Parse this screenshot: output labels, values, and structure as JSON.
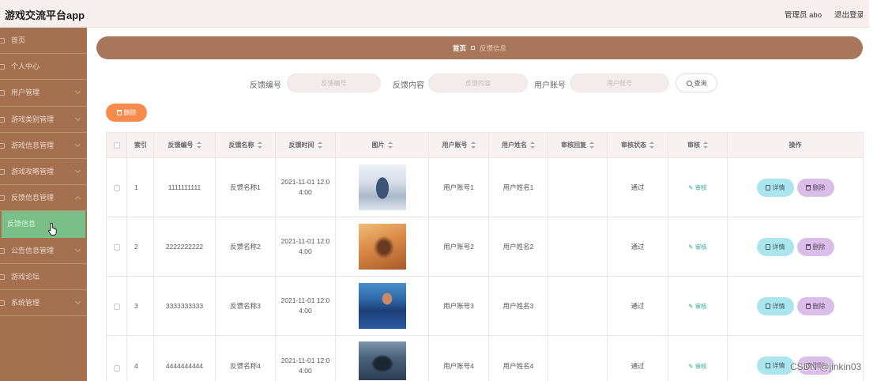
{
  "app": {
    "title": "游戏交流平台app",
    "user_label": "管理员 abo",
    "logout_label": "退出登录"
  },
  "sidebar": {
    "items": [
      {
        "label": "首页",
        "icon": "home-icon"
      },
      {
        "label": "个人中心",
        "icon": "person-icon"
      },
      {
        "label": "用户管理",
        "icon": "users-icon",
        "expandable": true
      },
      {
        "label": "游戏类别管理",
        "icon": "category-icon",
        "expandable": true
      },
      {
        "label": "游戏信息管理",
        "icon": "game-icon",
        "expandable": true
      },
      {
        "label": "游戏攻略管理",
        "icon": "guide-icon",
        "expandable": true
      },
      {
        "label": "反馈信息管理",
        "icon": "feedback-icon",
        "expandable": true,
        "expanded": true
      },
      {
        "label": "反馈信息",
        "active": true
      },
      {
        "label": "公告信息管理",
        "icon": "notice-icon",
        "expandable": true
      },
      {
        "label": "游戏论坛",
        "icon": "forum-icon"
      },
      {
        "label": "系统管理",
        "icon": "settings-icon",
        "expandable": true
      }
    ]
  },
  "breadcrumb": {
    "home": "首页",
    "current": "反馈信息"
  },
  "search": {
    "fields": [
      {
        "label": "反馈编号",
        "placeholder": "反馈编号"
      },
      {
        "label": "反馈内容",
        "placeholder": "反馈内容"
      },
      {
        "label": "用户账号",
        "placeholder": "用户账号"
      }
    ],
    "button_label": "查询"
  },
  "toolbar": {
    "delete_label": "删除"
  },
  "table": {
    "columns": [
      {
        "label": "索引",
        "sortable": false
      },
      {
        "label": "反馈编号",
        "sortable": true
      },
      {
        "label": "反馈名称",
        "sortable": true
      },
      {
        "label": "反馈时间",
        "sortable": true
      },
      {
        "label": "图片",
        "sortable": true
      },
      {
        "label": "用户账号",
        "sortable": true
      },
      {
        "label": "用户姓名",
        "sortable": true
      },
      {
        "label": "审核回复",
        "sortable": true
      },
      {
        "label": "审核状态",
        "sortable": true
      },
      {
        "label": "审核",
        "sortable": true
      },
      {
        "label": "操作",
        "sortable": false
      }
    ],
    "rows": [
      {
        "index": 1,
        "feedback_no": "1111111111",
        "feedback_name": "反馈名称1",
        "feedback_time": "2021-11-01 12:04:00",
        "user_account": "用户账号1",
        "user_name": "用户姓名1",
        "review_reply": "",
        "review_status": "通过"
      },
      {
        "index": 2,
        "feedback_no": "2222222222",
        "feedback_name": "反馈名称2",
        "feedback_time": "2021-11-01 12:04:00",
        "user_account": "用户账号2",
        "user_name": "用户姓名2",
        "review_reply": "",
        "review_status": "通过"
      },
      {
        "index": 3,
        "feedback_no": "3333333333",
        "feedback_name": "反馈名称3",
        "feedback_time": "2021-11-01 12:04:00",
        "user_account": "用户账号3",
        "user_name": "用户姓名3",
        "review_reply": "",
        "review_status": "通过"
      },
      {
        "index": 4,
        "feedback_no": "4444444444",
        "feedback_name": "反馈名称4",
        "feedback_time": "2021-11-01 12:04:00",
        "user_account": "用户账号4",
        "user_name": "用户姓名4",
        "review_reply": "",
        "review_status": "通过"
      }
    ]
  },
  "row_actions": {
    "review_label": "审核",
    "detail_label": "详情",
    "delete_label": "删除"
  },
  "watermark": "CSDN @jinkin03",
  "colors": {
    "sidebar": "#a37150",
    "active_menu_item": "#7bbf88",
    "breadcrumb_bar": "#a8775b",
    "toolbar_delete": "#f78a4d",
    "detail_button": "#abe6ef",
    "row_delete_button": "#dbbde9",
    "review_link": "#35a89b"
  }
}
